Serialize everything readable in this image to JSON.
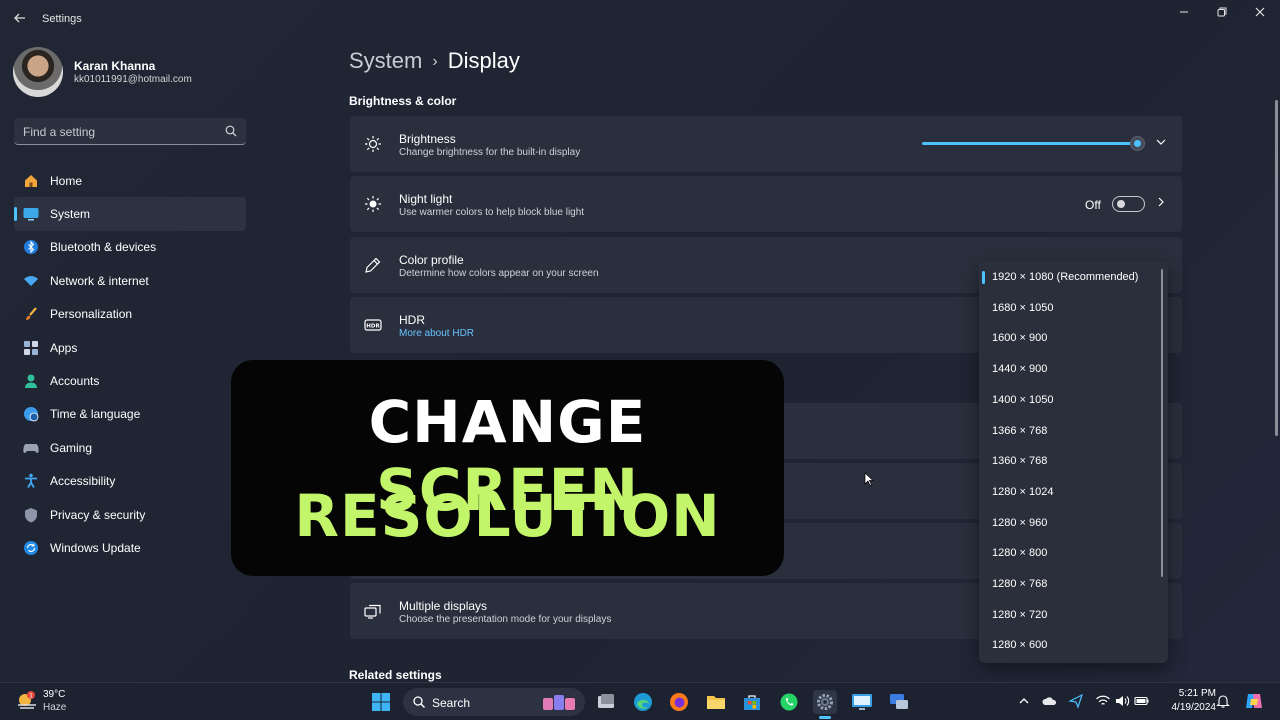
{
  "window": {
    "title": "Settings"
  },
  "profile": {
    "name": "Karan Khanna",
    "email": "kk01011991@hotmail.com"
  },
  "search": {
    "placeholder": "Find a setting"
  },
  "nav": [
    {
      "label": "Home",
      "icon": "home-icon"
    },
    {
      "label": "System",
      "icon": "system-icon",
      "active": true
    },
    {
      "label": "Bluetooth & devices",
      "icon": "bluetooth-icon"
    },
    {
      "label": "Network & internet",
      "icon": "wifi-icon"
    },
    {
      "label": "Personalization",
      "icon": "brush-icon"
    },
    {
      "label": "Apps",
      "icon": "apps-icon"
    },
    {
      "label": "Accounts",
      "icon": "person-icon"
    },
    {
      "label": "Time & language",
      "icon": "globe-icon"
    },
    {
      "label": "Gaming",
      "icon": "controller-icon"
    },
    {
      "label": "Accessibility",
      "icon": "accessibility-icon"
    },
    {
      "label": "Privacy & security",
      "icon": "shield-icon"
    },
    {
      "label": "Windows Update",
      "icon": "update-icon"
    }
  ],
  "breadcrumb": {
    "parent": "System",
    "current": "Display"
  },
  "section": {
    "brightness_color": "Brightness & color",
    "related": "Related settings"
  },
  "cards": {
    "brightness": {
      "title": "Brightness",
      "subtitle": "Change brightness for the built-in display",
      "level": 0.97
    },
    "night_light": {
      "title": "Night light",
      "subtitle": "Use warmer colors to help block blue light",
      "state": "Off"
    },
    "color_profile": {
      "title": "Color profile",
      "subtitle": "Determine how colors appear on your screen"
    },
    "hdr": {
      "title": "HDR",
      "subtitle": "More about HDR"
    },
    "multiple_displays": {
      "title": "Multiple displays",
      "subtitle": "Choose the presentation mode for your displays"
    }
  },
  "resolution_dropdown": {
    "options": [
      "1920 × 1080 (Recommended)",
      "1680 × 1050",
      "1600 × 900",
      "1440 × 900",
      "1400 × 1050",
      "1366 × 768",
      "1360 × 768",
      "1280 × 1024",
      "1280 × 960",
      "1280 × 800",
      "1280 × 768",
      "1280 × 720",
      "1280 × 600"
    ],
    "selected": "1920 × 1080 (Recommended)"
  },
  "banner": {
    "line1_white": "CHANGE",
    "line1_green": "SCREEN",
    "line2_green": "RESOLUTION"
  },
  "taskbar": {
    "weather": {
      "temp": "39°C",
      "condition": "Haze",
      "badge": "1"
    },
    "search_label": "Search",
    "time": "5:21 PM",
    "date": "4/19/2024"
  },
  "colors": {
    "accent": "#4cc2ff",
    "banner_green": "#c3f56a",
    "card_bg": "#2a2f3d"
  }
}
